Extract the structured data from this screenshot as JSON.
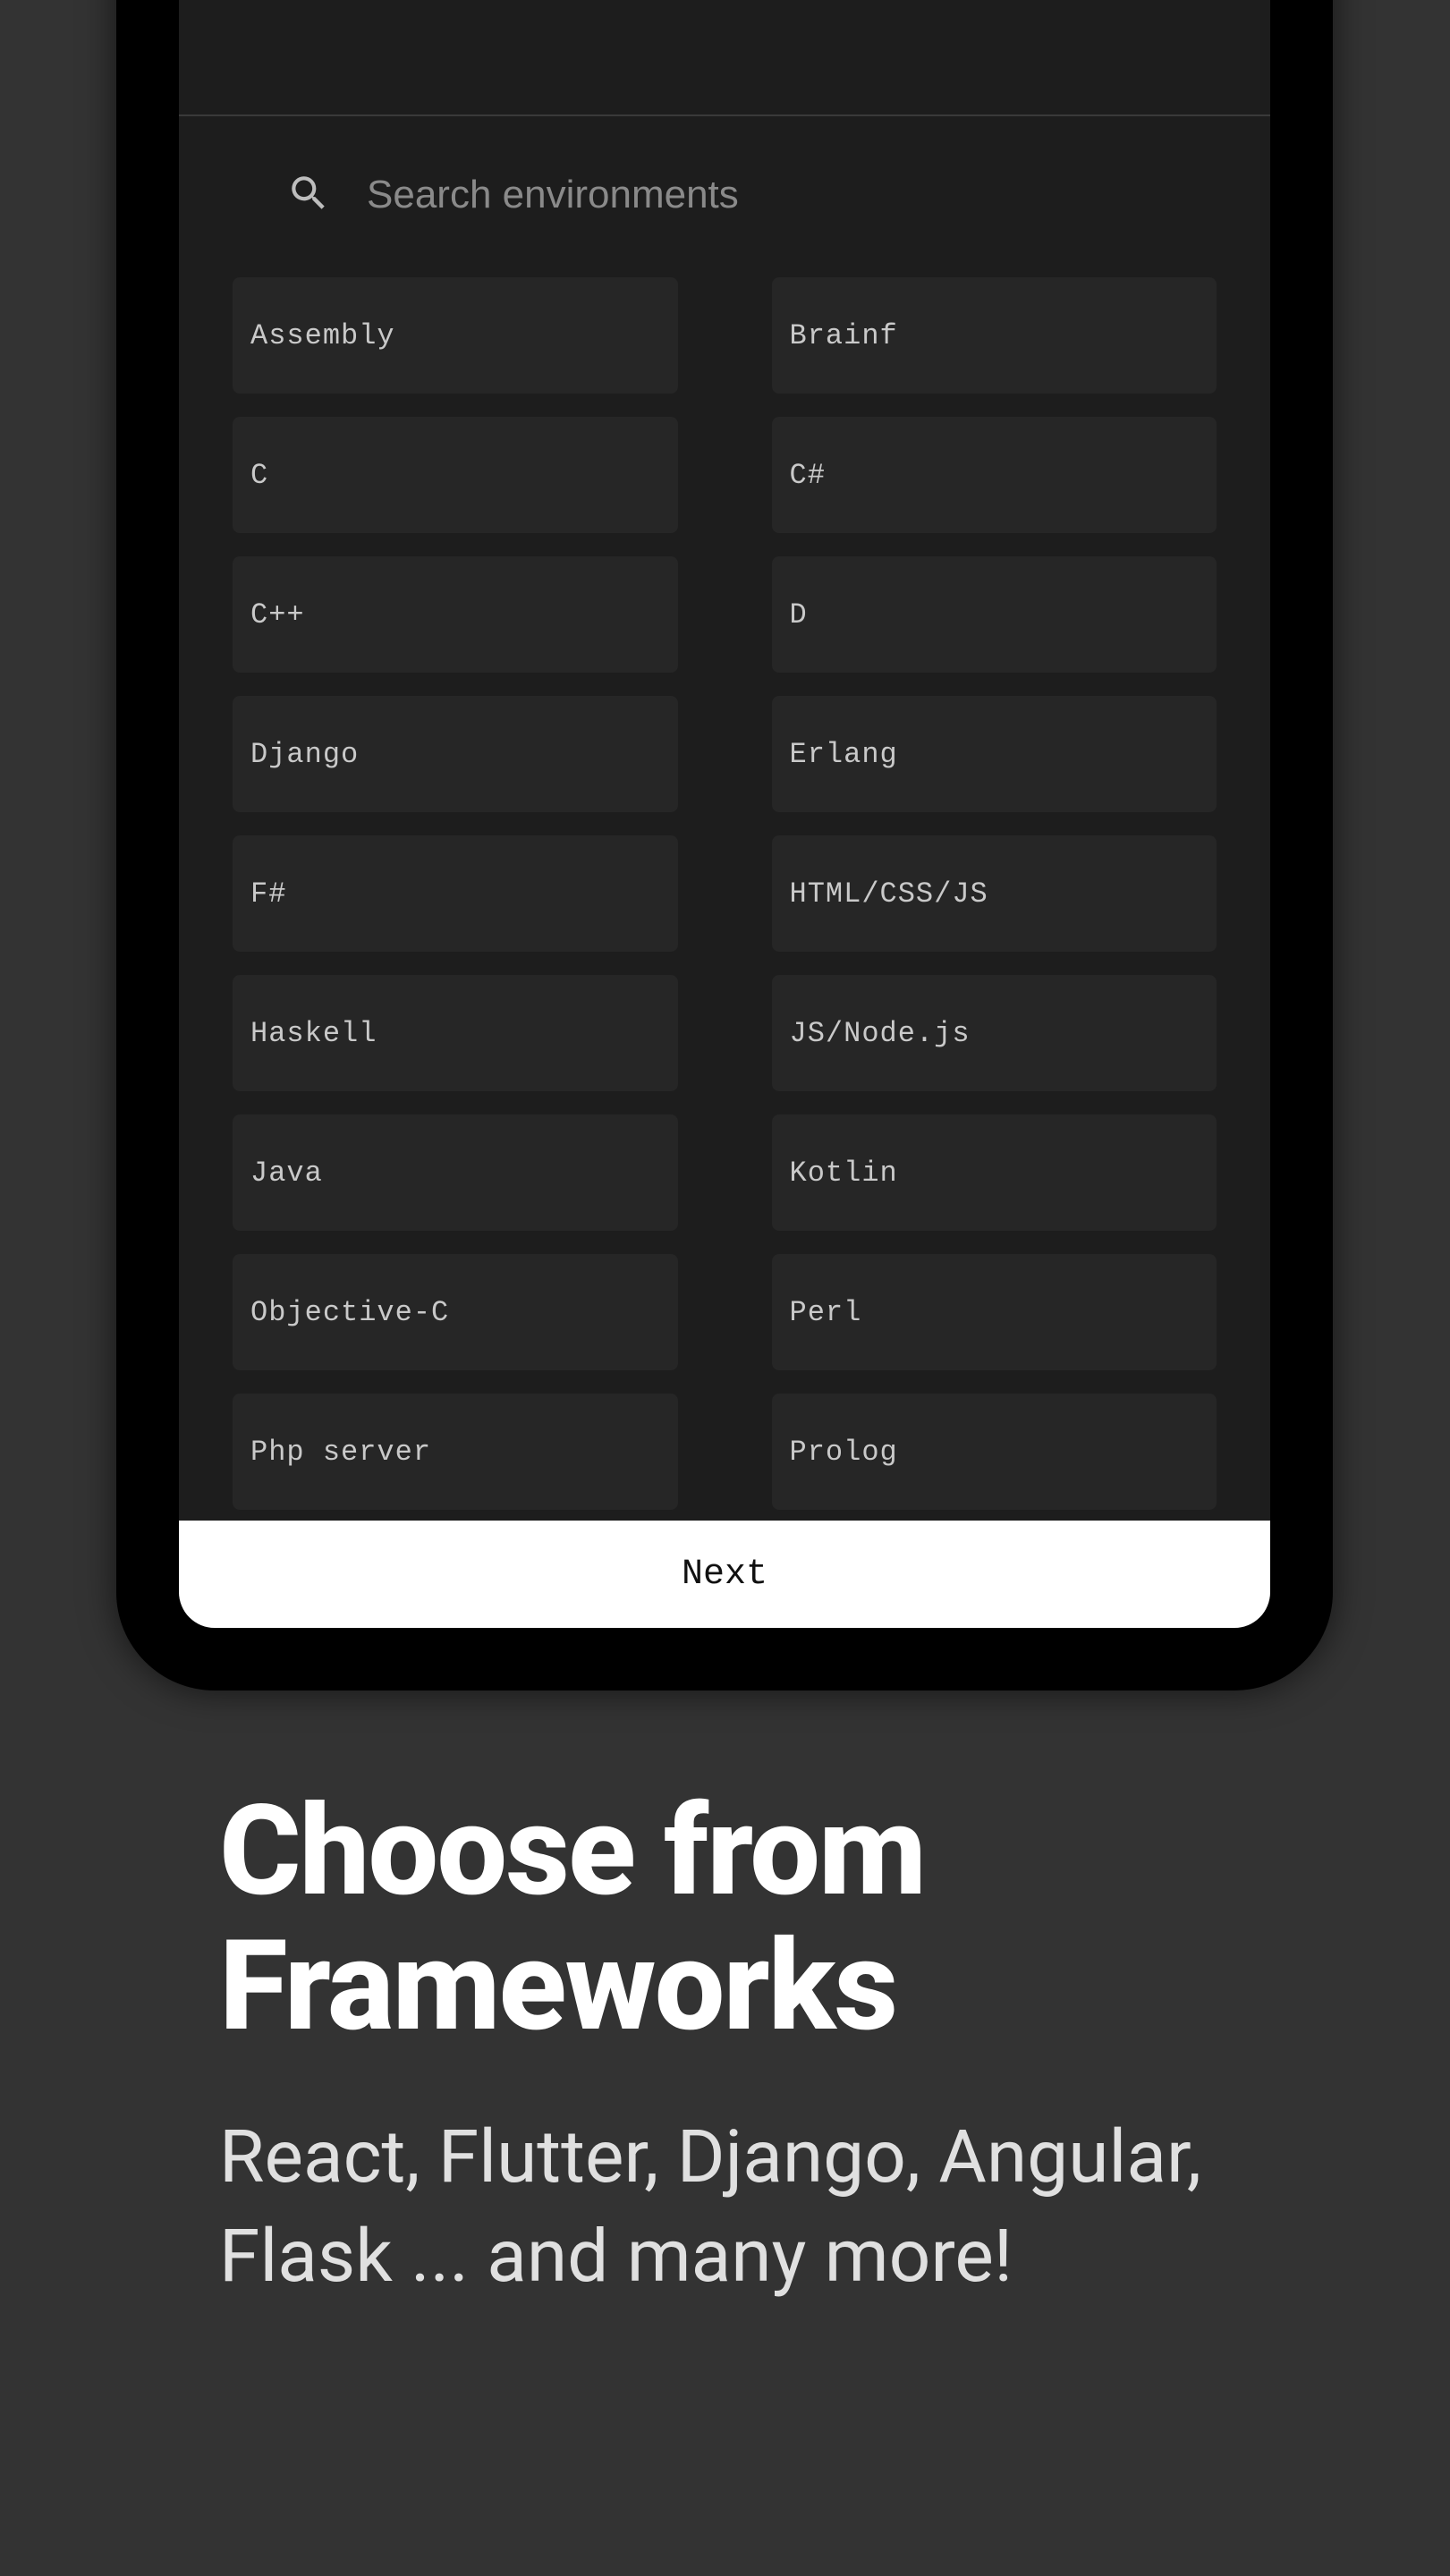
{
  "search": {
    "placeholder": "Search environments"
  },
  "environments": [
    "Assembly",
    "Brainf",
    "C",
    "C#",
    "C++",
    "D",
    "Django",
    "Erlang",
    "F#",
    "HTML/CSS/JS",
    "Haskell",
    "JS/Node.js",
    "Java",
    "Kotlin",
    "Objective-C",
    "Perl",
    "Php server",
    "Prolog"
  ],
  "next_label": "Next",
  "marketing": {
    "title": "Choose from Frameworks",
    "subtitle": "React, Flutter, Django, Angular, Flask ... and many more!"
  }
}
